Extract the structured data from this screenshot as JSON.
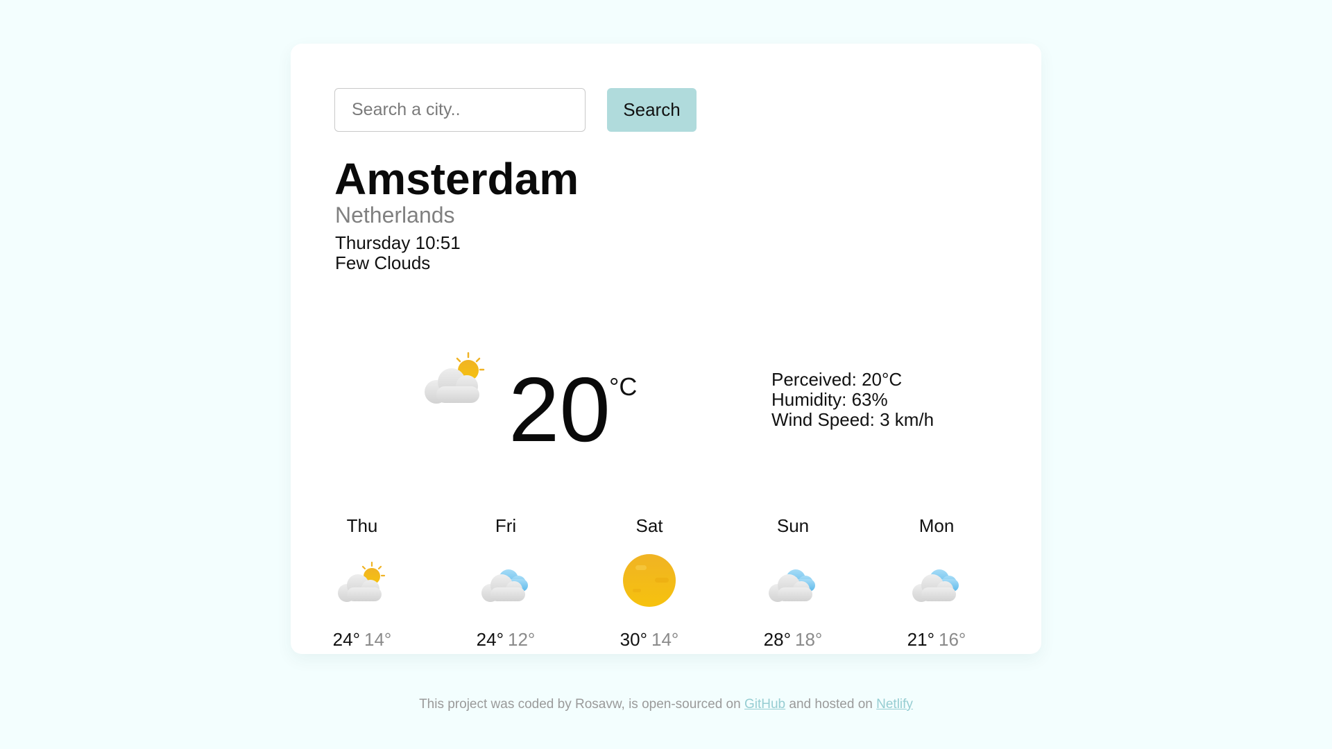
{
  "search": {
    "placeholder": "Search a city..",
    "button_label": "Search"
  },
  "current": {
    "city": "Amsterdam",
    "country": "Netherlands",
    "datetime": "Thursday 10:51",
    "condition": "Few Clouds",
    "icon": "few-clouds-icon",
    "temperature": "20",
    "unit": "°C",
    "perceived": "Perceived: 20°C",
    "humidity": "Humidity: 63%",
    "wind": "Wind Speed: 3 km/h"
  },
  "forecast": [
    {
      "day": "Thu",
      "icon": "few-clouds-icon",
      "max": "24°",
      "min": "14°"
    },
    {
      "day": "Fri",
      "icon": "cloudy-icon",
      "max": "24°",
      "min": "12°"
    },
    {
      "day": "Sat",
      "icon": "sun-icon",
      "max": "30°",
      "min": "14°"
    },
    {
      "day": "Sun",
      "icon": "cloudy-icon",
      "max": "28°",
      "min": "18°"
    },
    {
      "day": "Mon",
      "icon": "cloudy-icon",
      "max": "21°",
      "min": "16°"
    }
  ],
  "footer": {
    "prefix": "This project was coded by Rosavw, is open-sourced on",
    "github_link": "GitHub",
    "middle": "and hosted on",
    "netlify_link": "Netlify"
  },
  "colors": {
    "page_background": "#f3fefe",
    "card_background": "#ffffff",
    "accent_button": "#b0dbdc",
    "link": "#96cdd2",
    "sun": "#f3b51a"
  }
}
